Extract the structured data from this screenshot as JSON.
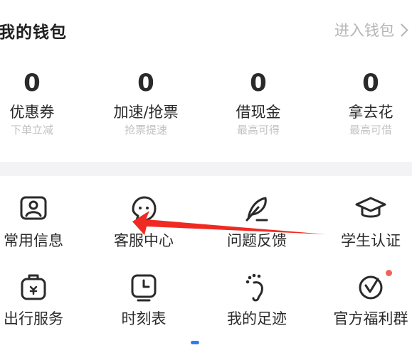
{
  "wallet": {
    "title": "我的钱包",
    "link_label": "进入钱包"
  },
  "stats": [
    {
      "value": "0",
      "label": "优惠券",
      "sub": "下单立减"
    },
    {
      "value": "0",
      "label": "加速/抢票",
      "sub": "抢票提速"
    },
    {
      "value": "0",
      "label": "借现金",
      "sub": "最高可得"
    },
    {
      "value": "0",
      "label": "拿去花",
      "sub": "最高可借"
    }
  ],
  "services": {
    "row1": [
      {
        "label": "常用信息",
        "icon": "contact-card-icon"
      },
      {
        "label": "客服中心",
        "icon": "customer-service-icon"
      },
      {
        "label": "问题反馈",
        "icon": "feather-pen-icon"
      },
      {
        "label": "学生认证",
        "icon": "graduation-cap-icon"
      }
    ],
    "row2": [
      {
        "label": "出行服务",
        "icon": "luggage-icon"
      },
      {
        "label": "时刻表",
        "icon": "clock-icon"
      },
      {
        "label": "我的足迹",
        "icon": "footprint-icon"
      },
      {
        "label": "官方福利群",
        "icon": "check-circle-icon",
        "has_badge": true
      }
    ]
  },
  "colors": {
    "accent": "#2f7cf6",
    "badge": "#f0635a",
    "annotation_arrow": "#f02a22",
    "muted_text": "#c2c2c2"
  }
}
